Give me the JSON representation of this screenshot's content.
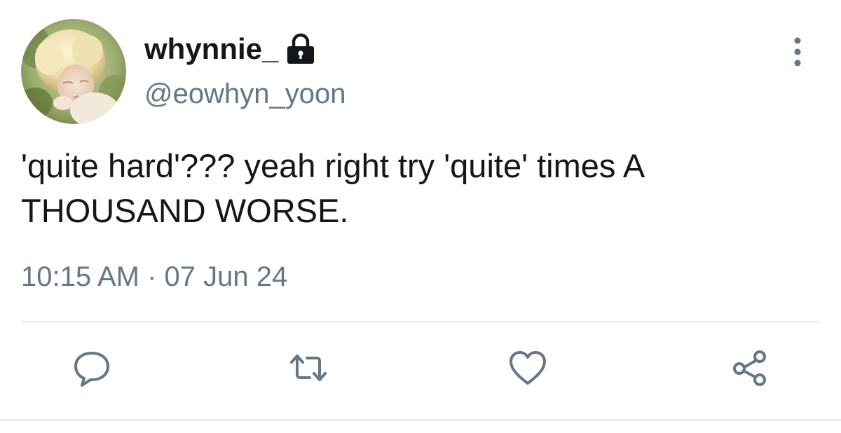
{
  "user": {
    "display_name": "whynnie_",
    "handle": "@eowhyn_yoon",
    "avatar_icon": "profile-photo",
    "protected_icon": "lock-icon"
  },
  "tweet": {
    "text": "'quite hard'??? yeah right try 'quite' times A THOUSAND WORSE.",
    "timestamp": "10:15 AM · 07 Jun 24"
  },
  "actions": {
    "reply_icon": "reply-icon",
    "retweet_icon": "retweet-icon",
    "like_icon": "heart-icon",
    "share_icon": "share-icon",
    "more_icon": "more-vertical-icon"
  },
  "colors": {
    "text_primary": "#14171a",
    "text_secondary": "#657786",
    "icon_color": "#657786",
    "divider": "#e6ecf0"
  }
}
